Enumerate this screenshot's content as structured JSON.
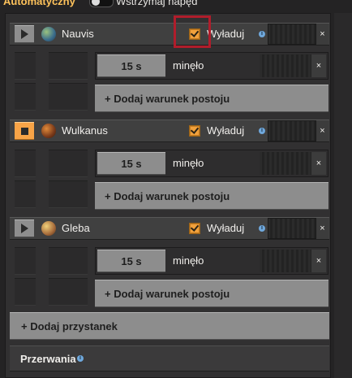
{
  "header": {
    "mode_label": "Automatyczny",
    "halt_label": "Wstrzymaj napęd"
  },
  "stations": [
    {
      "name": "Nauvis",
      "state": "paused",
      "planet_icon": "nauvis-planet-icon",
      "unload_label": "Wyładuj",
      "unload_checked": true,
      "condition": {
        "duration": "15 s",
        "label": "minęło"
      },
      "add_condition_label": "+ Dodaj warunek postoju"
    },
    {
      "name": "Wulkanus",
      "state": "active",
      "planet_icon": "vulcanus-planet-icon",
      "unload_label": "Wyładuj",
      "unload_checked": true,
      "condition": {
        "duration": "15 s",
        "label": "minęło"
      },
      "add_condition_label": "+ Dodaj warunek postoju"
    },
    {
      "name": "Gleba",
      "state": "paused",
      "planet_icon": "gleba-planet-icon",
      "unload_label": "Wyładuj",
      "unload_checked": true,
      "condition": {
        "duration": "15 s",
        "label": "minęło"
      },
      "add_condition_label": "+ Dodaj warunek postoju"
    }
  ],
  "footer": {
    "add_stop_label": "+ Dodaj przystanek",
    "interrupts_label": "Przerwania"
  },
  "icons": {
    "close": "×",
    "info": "i"
  },
  "colors": {
    "accent": "#ffc35b",
    "active_button": "#f8a447",
    "checkbox": "#f1a13c",
    "highlight": "#b01d2b"
  }
}
